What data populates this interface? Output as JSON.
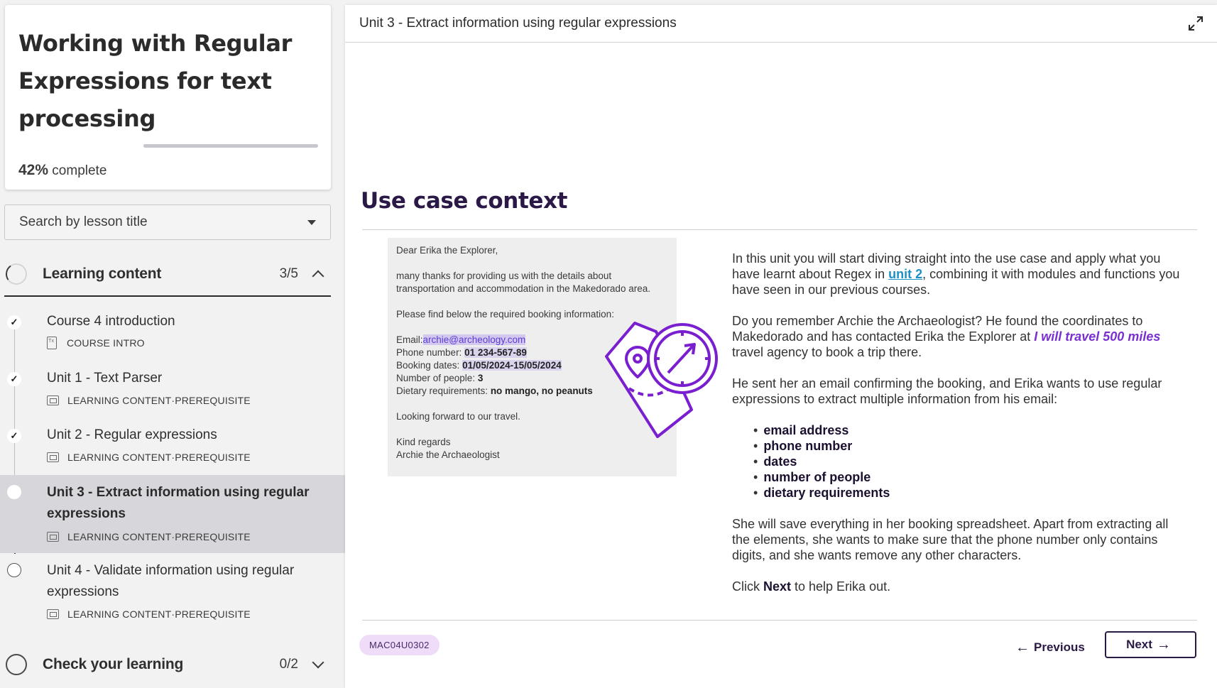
{
  "course": {
    "title": "Working with Regular Expressions for text processing",
    "progress_value": "42%",
    "progress_suffix": " complete",
    "progress_fraction": 0.42
  },
  "search": {
    "placeholder": "Search by lesson title"
  },
  "sections": [
    {
      "title": "Learning content",
      "count": "3/5",
      "expanded": true
    },
    {
      "title": "Check your learning",
      "count": "0/2",
      "expanded": false
    }
  ],
  "lessons": [
    {
      "title": "Course 4 introduction",
      "meta": "COURSE INTRO",
      "completed": true
    },
    {
      "title": "Unit 1 - Text Parser",
      "meta_type": "LEARNING CONTENT",
      "meta_tag": "PREREQUISITE",
      "completed": true
    },
    {
      "title": "Unit 2 - Regular expressions",
      "meta_type": "LEARNING CONTENT",
      "meta_tag": "PREREQUISITE",
      "completed": true
    },
    {
      "title_line1": "Unit 3 - Extract information using regular",
      "title_line2": "expressions",
      "meta_type": "LEARNING CONTENT",
      "meta_tag": "PREREQUISITE",
      "active": true
    },
    {
      "title_line1": "Unit 4 - Validate information using regular",
      "title_line2": "expressions",
      "meta_type": "LEARNING CONTENT",
      "meta_tag": "PREREQUISITE",
      "completed": false
    }
  ],
  "meta_separator": " · ",
  "main": {
    "unit_title": "Unit 3 - Extract information using regular expressions",
    "heading": "Use case context",
    "email": {
      "greeting": "Dear Erika the Explorer,",
      "p1": "many thanks for providing us with the details about transportation and accommodation in the Makedorado area.",
      "p2": "Please find below the required booking information:",
      "email_label": "Email:",
      "email_value": "archie@archeology.com",
      "phone_label": "Phone number: ",
      "phone_value": "01 234-567-89",
      "dates_label": "Booking dates: ",
      "dates_value": "01/05/2024-15/05/2024",
      "people_label": "Number of people: ",
      "people_value": "3",
      "diet_label": "Dietary requirements: ",
      "diet_value": "no mango, no peanuts",
      "closing1": "Looking forward to our travel.",
      "closing2": "Kind regards",
      "signature": "Archie the Archaeologist"
    },
    "text": {
      "p1_a": "In this unit you will start diving straight into the use case and apply what you have learnt about Regex in ",
      "p1_link": "unit 2",
      "p1_b": ", combining it with modules and functions you have seen in our previous courses.",
      "p2_a": "Do you remember Archie the Archaeologist? He found the coordinates to Makedorado and has contacted Erika the Explorer at ",
      "p2_brand": "I will travel 500 miles",
      "p2_b": " travel agency to book a trip there.",
      "p3": "He sent her an email confirming the booking, and Erika wants to use regular expressions to extract multiple information from his email:",
      "bullets": [
        "email address",
        "phone number",
        "dates",
        "number of people",
        "dietary requirements"
      ],
      "p4": "She will save everything in her booking spreadsheet. Apart from extracting all the elements, she wants to make sure that the phone number only contains digits, and she wants remove any other characters.",
      "p5_a": "Click ",
      "p5_b": "Next",
      "p5_c": " to help Erika out."
    },
    "code": "MAC04U0302",
    "prev_label": "Previous",
    "next_label": "Next"
  },
  "colors": {
    "accent": "#2a1846",
    "brand_purple": "#7a2fd0",
    "link": "#1e90c8",
    "active_row": "#d7d7db"
  },
  "icons": [
    "chevron-down-icon",
    "chevron-up-icon",
    "check-icon",
    "expand-icon",
    "arrow-left-icon",
    "arrow-right-icon",
    "map-compass-icon"
  ]
}
